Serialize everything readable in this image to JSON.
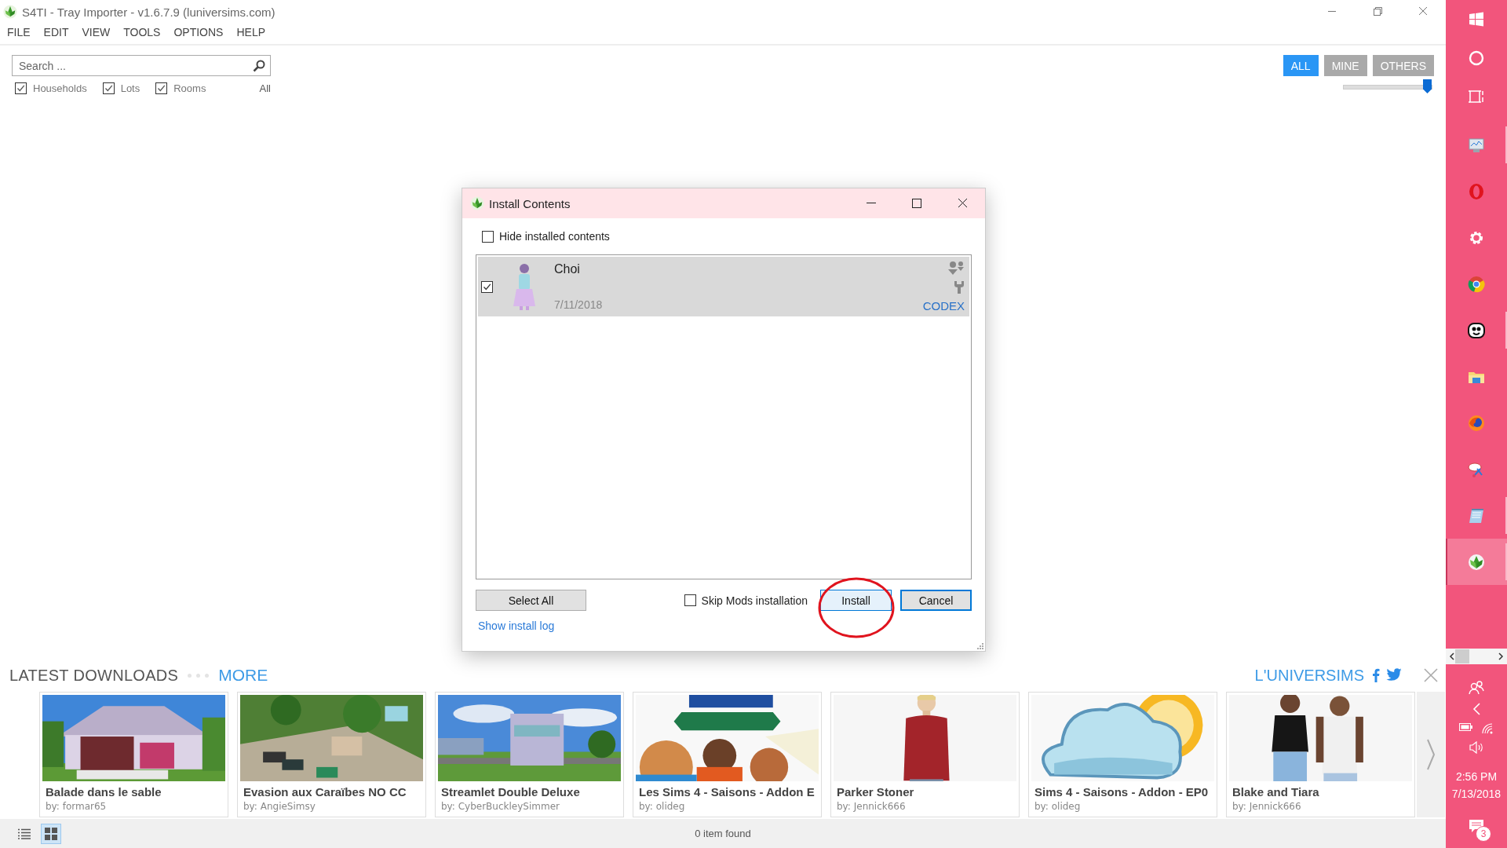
{
  "window": {
    "title": "S4TI - Tray Importer - v1.6.7.9  (luniversims.com)"
  },
  "menu": [
    "FILE",
    "EDIT",
    "VIEW",
    "TOOLS",
    "OPTIONS",
    "HELP"
  ],
  "search": {
    "placeholder": "Search ..."
  },
  "filters": [
    {
      "label": "Households",
      "checked": true
    },
    {
      "label": "Lots",
      "checked": true
    },
    {
      "label": "Rooms",
      "checked": true
    }
  ],
  "all_link": "All",
  "scope_buttons": [
    {
      "label": "ALL",
      "selected": true
    },
    {
      "label": "MINE",
      "selected": false
    },
    {
      "label": "OTHERS",
      "selected": false
    }
  ],
  "size_slider": {
    "level": 1
  },
  "dialog": {
    "title": "Install Contents",
    "hide_installed": {
      "label": "Hide installed contents",
      "checked": false
    },
    "items": [
      {
        "name": "Choi",
        "date": "7/11/2018",
        "source": "CODEX",
        "checked": true,
        "selected": true
      }
    ],
    "select_all": "Select All",
    "skip_mods": {
      "label": "Skip Mods installation",
      "checked": false
    },
    "install": "Install",
    "cancel": "Cancel",
    "log_link": "Show install log"
  },
  "latest_downloads": {
    "title": "LATEST DOWNLOADS",
    "more": "MORE",
    "brand": "L'UNIVERSIMS",
    "items": [
      {
        "title": "Balade dans le sable",
        "author": "by: formar65"
      },
      {
        "title": "Evasion aux Caraïbes NO CC",
        "author": "by: AngieSimsy"
      },
      {
        "title": "Streamlet Double Deluxe",
        "author": "by: CyberBuckleySimmer"
      },
      {
        "title": "Les Sims 4 - Saisons - Addon E",
        "author": "by: olideg"
      },
      {
        "title": "Parker Stoner",
        "author": "by: Jennick666"
      },
      {
        "title": "Sims 4 - Saisons - Addon - EP0",
        "author": "by: olideg"
      },
      {
        "title": "Blake and Tiara",
        "author": "by: Jennick666"
      }
    ]
  },
  "status_bar": {
    "text": "0 item found",
    "view_modes": [
      {
        "kind": "list",
        "selected": false
      },
      {
        "kind": "grid",
        "selected": true
      }
    ]
  },
  "taskbar": {
    "system": [
      {
        "kind": "windows"
      },
      {
        "kind": "cortana"
      },
      {
        "kind": "taskview"
      }
    ],
    "apps": [
      {
        "kind": "monitor",
        "running": true,
        "selected": false
      },
      {
        "kind": "opera",
        "running": false,
        "selected": false
      },
      {
        "kind": "gear",
        "running": false,
        "selected": false
      },
      {
        "kind": "chrome",
        "running": false,
        "selected": false
      },
      {
        "kind": "imvu",
        "running": true,
        "selected": false
      },
      {
        "kind": "folder",
        "running": false,
        "selected": false
      },
      {
        "kind": "firefox",
        "running": false,
        "selected": false
      },
      {
        "kind": "snip",
        "running": false,
        "selected": false
      },
      {
        "kind": "notepad",
        "running": true,
        "selected": false
      },
      {
        "kind": "sims",
        "running": true,
        "selected": true
      }
    ],
    "time": "2:56 PM",
    "date": "7/13/2018",
    "notifications": "3"
  }
}
